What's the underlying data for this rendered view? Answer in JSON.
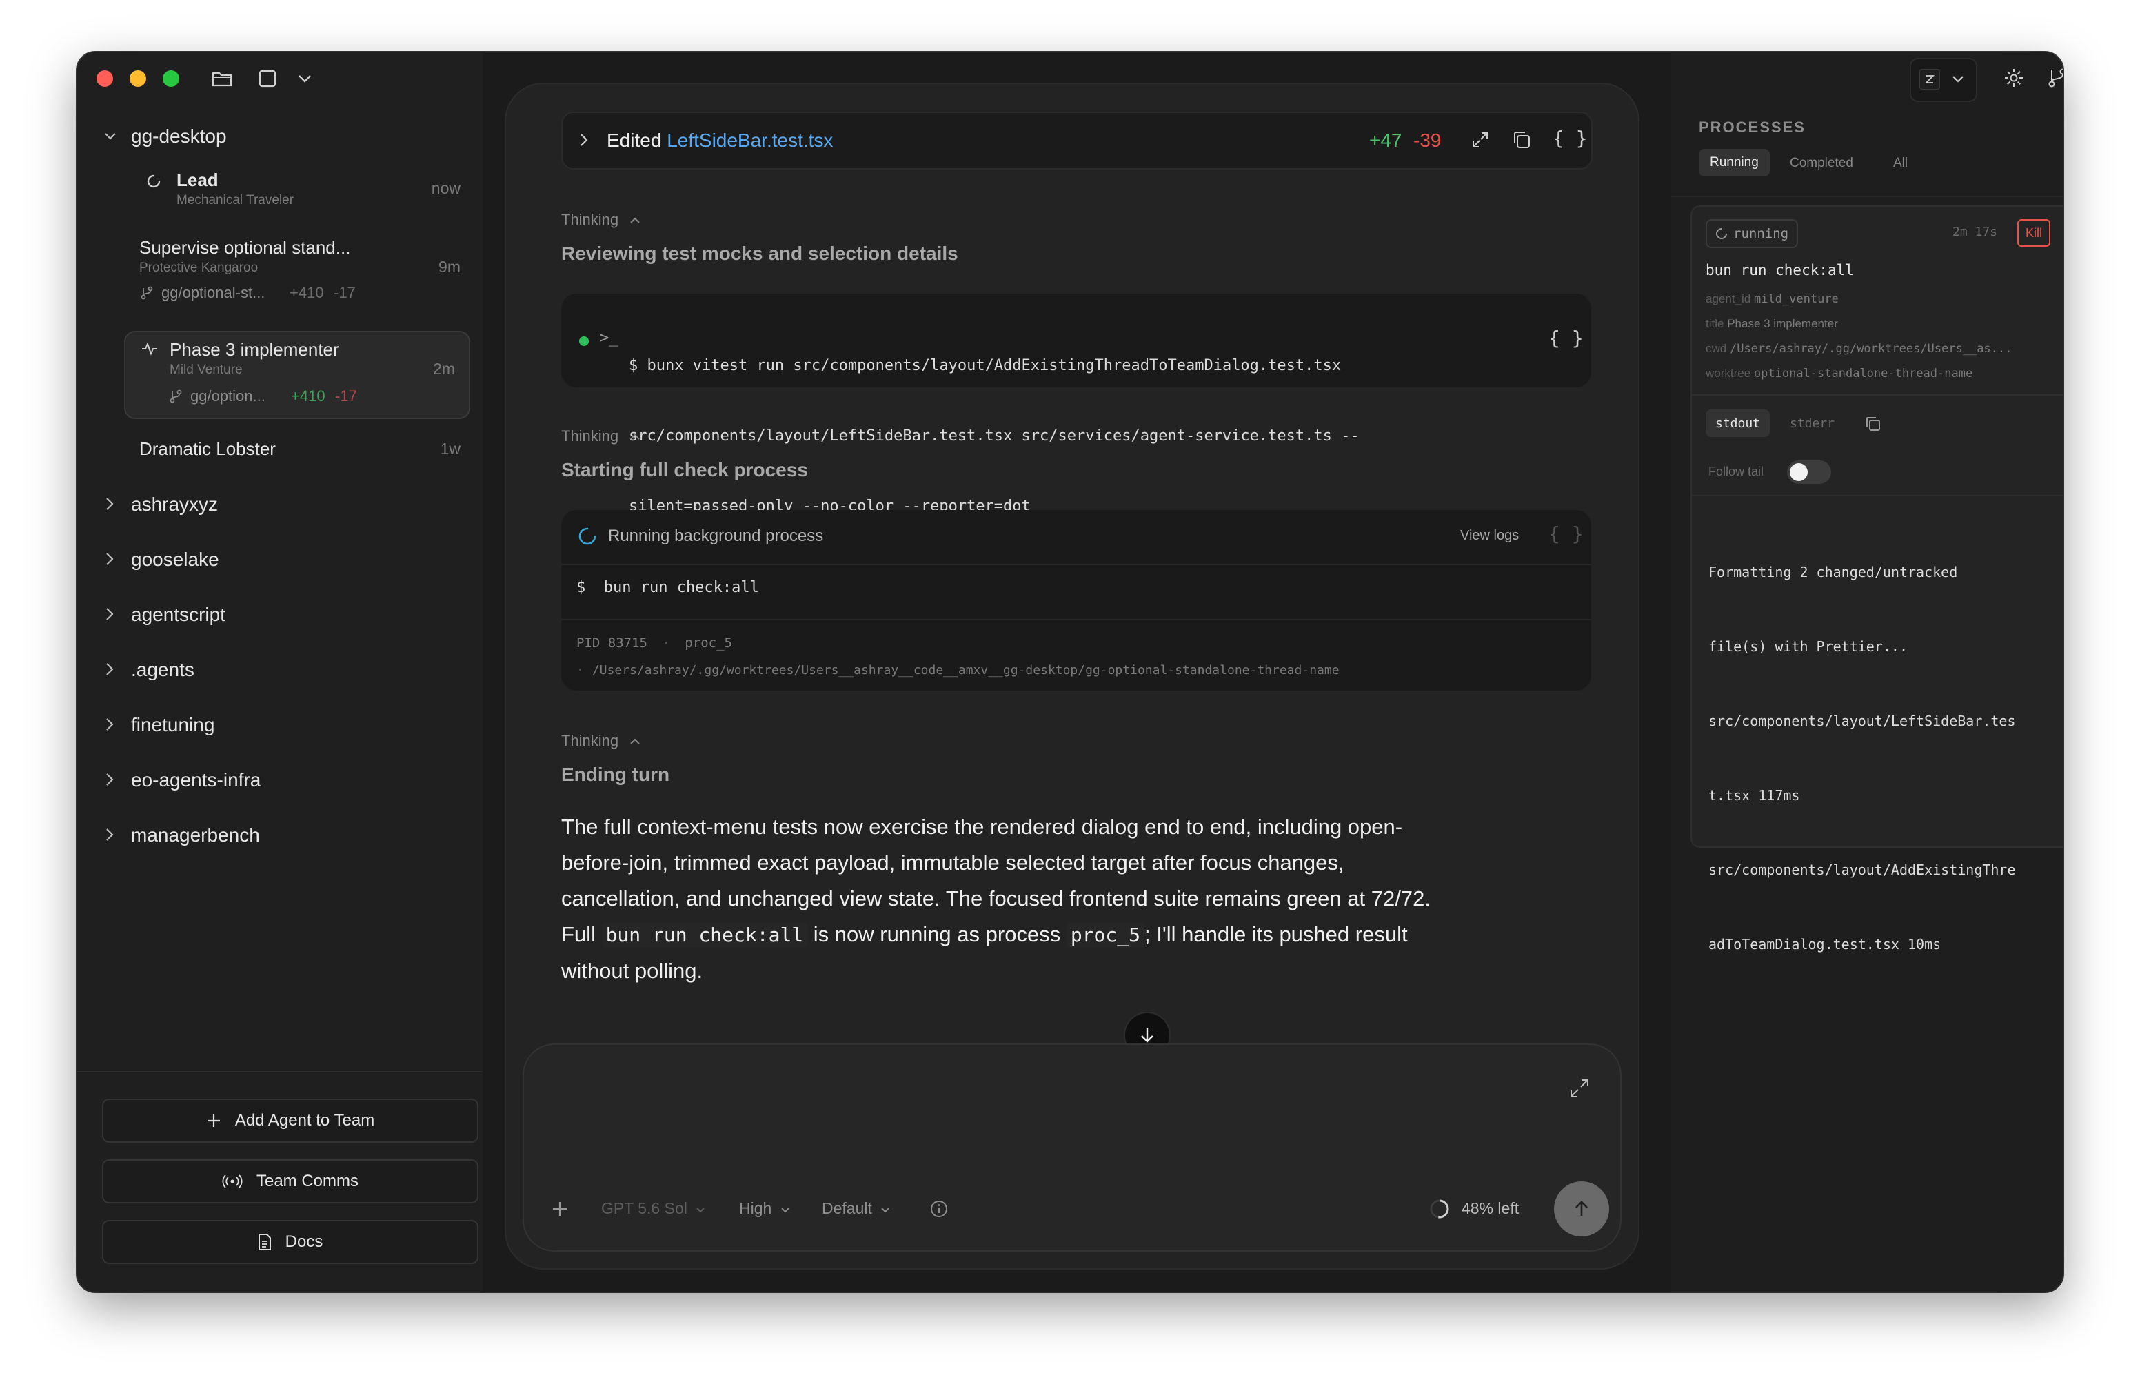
{
  "sidebar": {
    "project": "gg-desktop",
    "threads": [
      {
        "title": "Lead",
        "subtitle": "Mechanical Traveler",
        "time": "now"
      },
      {
        "title": "Supervise optional stand...",
        "subtitle": "Protective Kangaroo",
        "time": "9m",
        "branch": "gg/optional-st...",
        "added": "+410",
        "removed": "-17"
      },
      {
        "title": "Phase 3 implementer",
        "subtitle": "Mild Venture",
        "time": "2m",
        "branch": "gg/option...",
        "added": "+410",
        "removed": "-17"
      },
      {
        "title": "Dramatic Lobster",
        "time": "1w"
      }
    ],
    "projects": [
      "ashrayxyz",
      "gooselake",
      "agentscript",
      ".agents",
      "finetuning",
      "eo-agents-infra",
      "managerbench"
    ],
    "buttons": {
      "add_agent": "Add Agent to Team",
      "team_comms": "Team Comms",
      "docs": "Docs"
    }
  },
  "main": {
    "edit": {
      "prefix": "Edited",
      "file": "LeftSideBar.test.tsx",
      "added": "+47",
      "removed": "-39"
    },
    "blocks": [
      {
        "label": "Thinking",
        "title": "Reviewing test mocks and selection details"
      },
      {
        "label": "Thinking",
        "title": "Starting full check process"
      },
      {
        "label": "Thinking",
        "title": "Ending turn"
      }
    ],
    "command1": {
      "prompt": "$",
      "lines": [
        "bunx vitest run src/components/layout/AddExistingThreadToTeamDialog.test.tsx",
        "src/components/layout/LeftSideBar.test.tsx src/services/agent-service.test.ts --",
        "silent=passed-only --no-color --reporter=dot"
      ]
    },
    "process_card": {
      "status": "Running background process",
      "view_logs": "View logs",
      "command": "$  bun run check:all",
      "pid": "PID 83715",
      "proc": "proc_5",
      "path": "/Users/ashray/.gg/worktrees/Users__ashray__code__amxv__gg-desktop/gg-optional-standalone-thread-name"
    },
    "message": {
      "l1": "The full context-menu tests now exercise the rendered dialog end to end, including open-",
      "l2": "before-join, trimmed exact payload, immutable selected target after focus changes,",
      "l3": "cancellation, and unchanged view state. The focused frontend suite remains green at 72/72.",
      "l4a": "Full",
      "l4code1": "bun run check:all",
      "l4b": "is now running as process",
      "l4code2": "proc_5",
      "l4c": "; I'll handle its pushed result",
      "l5": "without polling."
    },
    "composer": {
      "model": "GPT 5.6 Sol",
      "effort": "High",
      "mode": "Default",
      "context": "48% left",
      "context_fraction": 0.48
    }
  },
  "processes": {
    "heading": "PROCESSES",
    "tabs": [
      "Running",
      "Completed",
      "All"
    ],
    "item": {
      "status": "running",
      "duration": "2m 17s",
      "kill": "Kill",
      "command": "bun run check:all",
      "agent_label": "agent_id",
      "agent": "mild_venture",
      "title_label": "title",
      "title": "Phase 3 implementer",
      "cwd_label": "cwd",
      "cwd": "/Users/ashray/.gg/worktrees/Users__as...",
      "worktree_label": "worktree",
      "worktree": "optional-standalone-thread-name"
    },
    "stream_tabs": [
      "stdout",
      "stderr"
    ],
    "follow_tail": "Follow tail",
    "follow_tail_on": false,
    "output": [
      "Formatting 2 changed/untracked",
      "file(s) with Prettier...",
      "src/components/layout/LeftSideBar.tes",
      "t.tsx 117ms",
      "src/components/layout/AddExistingThre",
      "adToTeamDialog.test.tsx 10ms"
    ]
  },
  "colors": {
    "accent_blue": "#5aa9f0",
    "added": "#4fc26a",
    "removed": "#e5534b",
    "kill": "#e5534b"
  }
}
